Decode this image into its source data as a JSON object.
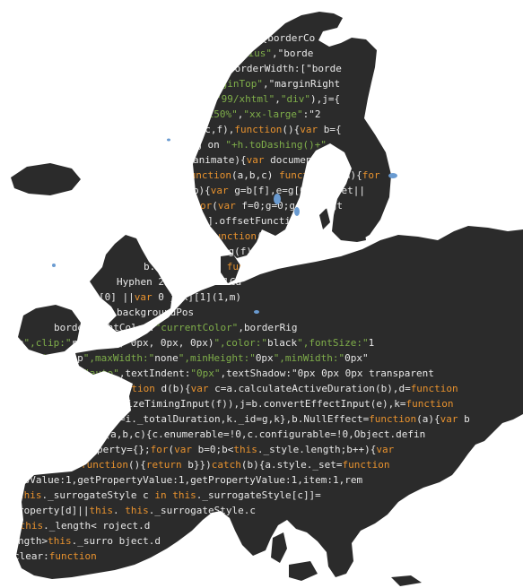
{
  "image": {
    "subject": "europe-map-code-texture",
    "colors": {
      "land": "#2b2b2b",
      "background": "#ffffff",
      "keyword": "#e8922e",
      "string": "#7fae4a",
      "text": "#e8e8e8",
      "lakes": "#6a9bd1"
    }
  },
  "code_lines": [
    "){borderCo",
    "\"Radius\",\"borde",
    "borderWidth:[\"borde",
    "\"ginTop\",\"marginRight",
    "\"99/xhtml\",\"div\"),j={",
    "\"150%\",\"xx-large\":\"2",
    "f(c,f),function(){var b={",
    "ing on \"+h.toDashing()+\"",
    "animate){var document.doc",
    "function(a,b,c) function d(a){for",
    "in b){var g=b[f],e=g[0].offset||",
    "e in c)for(var f=0;g=0;g<f.lengt",
    "Offset:f[i].offsetFunction>",
    "ctInput=function(c",
    "d=0==f.easing(f);b.e",
    "b.toUpperCase function",
    "Hyphen  2016-0  camelCa",
    "[0]  ||var 0  j[k][1](1,m)",
    "backgroundPos",
    "borderRightColor:\"currentColor\",borderRig",
    "auto\",clip:\"rect(0px, 0px, 0px, 0px)\",color:\"black\",fontSize:\"1",
    "0px\",height:\"p\",maxWidth:\"none\",minHeight:\"0px\",minWidth:\"0px\"",
    "ight:\"auto\",textIndent:\"0px\",textShadow:\"0px 0px 0px transparent",
    "c){function d(b){var c=a.calculateActiveDuration(b),d=function",
    "d(a.normalizeTimingInput(f)),j=b.convertEffectInput(e),k=function",
    "Duration=i._totalDuration,k._id=g,k},b.NullEffect=function(a){var b",
    "on c(a,b,c){c.enumerable=!0,c.configurable=!0,Object.defin",
    "matedProperty={};for(var b=0;b<this._style.length;b++){var",
    "function(){return b}})catch(b){a.style._set=function",
    "ssValue:1,getPropertyValue:1,getPropertyValue:1,item:1,rem",
    "this._surrogateStyle  c in this._surrogateStyle[c]]=",
    "roperty[d]||this.  this._surrogateStyle.c",
    ";this._length<  roject.d",
    "ngth>this._surro  bject.d",
    "clear:function"
  ]
}
